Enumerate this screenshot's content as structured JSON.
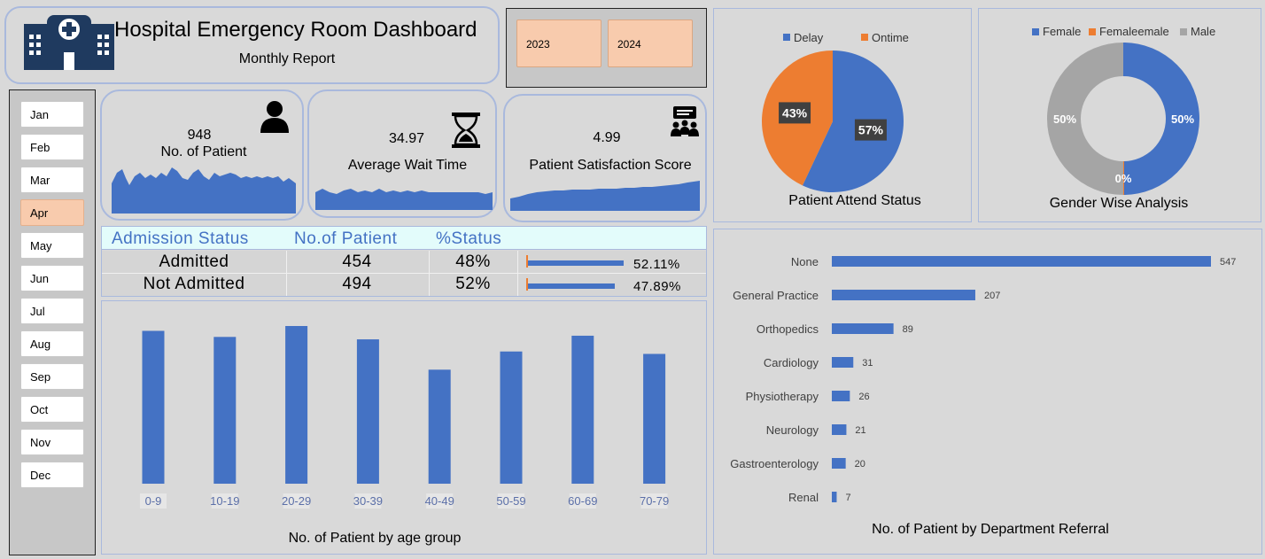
{
  "header": {
    "title": "Hospital Emergency Room Dashboard",
    "subtitle": "Monthly Report"
  },
  "years": [
    "2023",
    "2024"
  ],
  "months": {
    "items": [
      "Jan",
      "Feb",
      "Mar",
      "Apr",
      "May",
      "Jun",
      "Jul",
      "Aug",
      "Sep",
      "Oct",
      "Nov",
      "Dec"
    ],
    "selected": "Apr"
  },
  "kpis": {
    "patients": {
      "value": "948",
      "label": "No. of Patient"
    },
    "wait": {
      "value": "34.97",
      "label": "Average Wait Time"
    },
    "satisfaction": {
      "value": "4.99",
      "label": "Patient Satisfaction Score"
    }
  },
  "admission": {
    "headers": [
      "Admission Status",
      "No.of Patient",
      "%Status"
    ],
    "rows": [
      {
        "status": "Admitted",
        "count": "454",
        "pct": "48%",
        "bar_pct": "52.11%",
        "bar_value": 0.5211
      },
      {
        "status": "Not Admitted",
        "count": "494",
        "pct": "52%",
        "bar_pct": "47.89%",
        "bar_value": 0.4789
      }
    ]
  },
  "colors": {
    "blue": "#4472c4",
    "orange": "#ed7d31",
    "gray": "#a5a5a5",
    "panel": "#d9d9d9",
    "border": "#a9b9dd",
    "accent": "#f8cbad"
  },
  "icons": {
    "logo": "hospital-icon",
    "patients": "person-icon",
    "wait": "hourglass-icon",
    "satisfaction": "group-feedback-icon"
  },
  "chart_data": [
    {
      "type": "bar",
      "title": "No. of Patient by age group",
      "categories": [
        "0-9",
        "10-19",
        "20-29",
        "30-39",
        "40-49",
        "50-59",
        "60-69",
        "70-79"
      ],
      "values": [
        126,
        121,
        130,
        119,
        94,
        109,
        122,
        107
      ],
      "ylim": [
        0,
        130
      ]
    },
    {
      "type": "pie",
      "title": "Patient Attend Status",
      "legend": [
        "Delay",
        "Ontime"
      ],
      "values": [
        57,
        43
      ],
      "labels": [
        "57%",
        "43%"
      ]
    },
    {
      "type": "pie",
      "subtype": "donut",
      "title": "Gender Wise Analysis",
      "legend": [
        "Female",
        "Femaleemale",
        "Male"
      ],
      "values": [
        50,
        0,
        50
      ],
      "labels": [
        "50%",
        "0%",
        "50%"
      ]
    },
    {
      "type": "bar",
      "orientation": "horizontal",
      "title": "No. of Patient by Department Referral",
      "categories": [
        "None",
        "General Practice",
        "Orthopedics",
        "Cardiology",
        "Physiotherapy",
        "Neurology",
        "Gastroenterology",
        "Renal"
      ],
      "values": [
        547,
        207,
        89,
        31,
        26,
        21,
        20,
        7
      ]
    }
  ]
}
